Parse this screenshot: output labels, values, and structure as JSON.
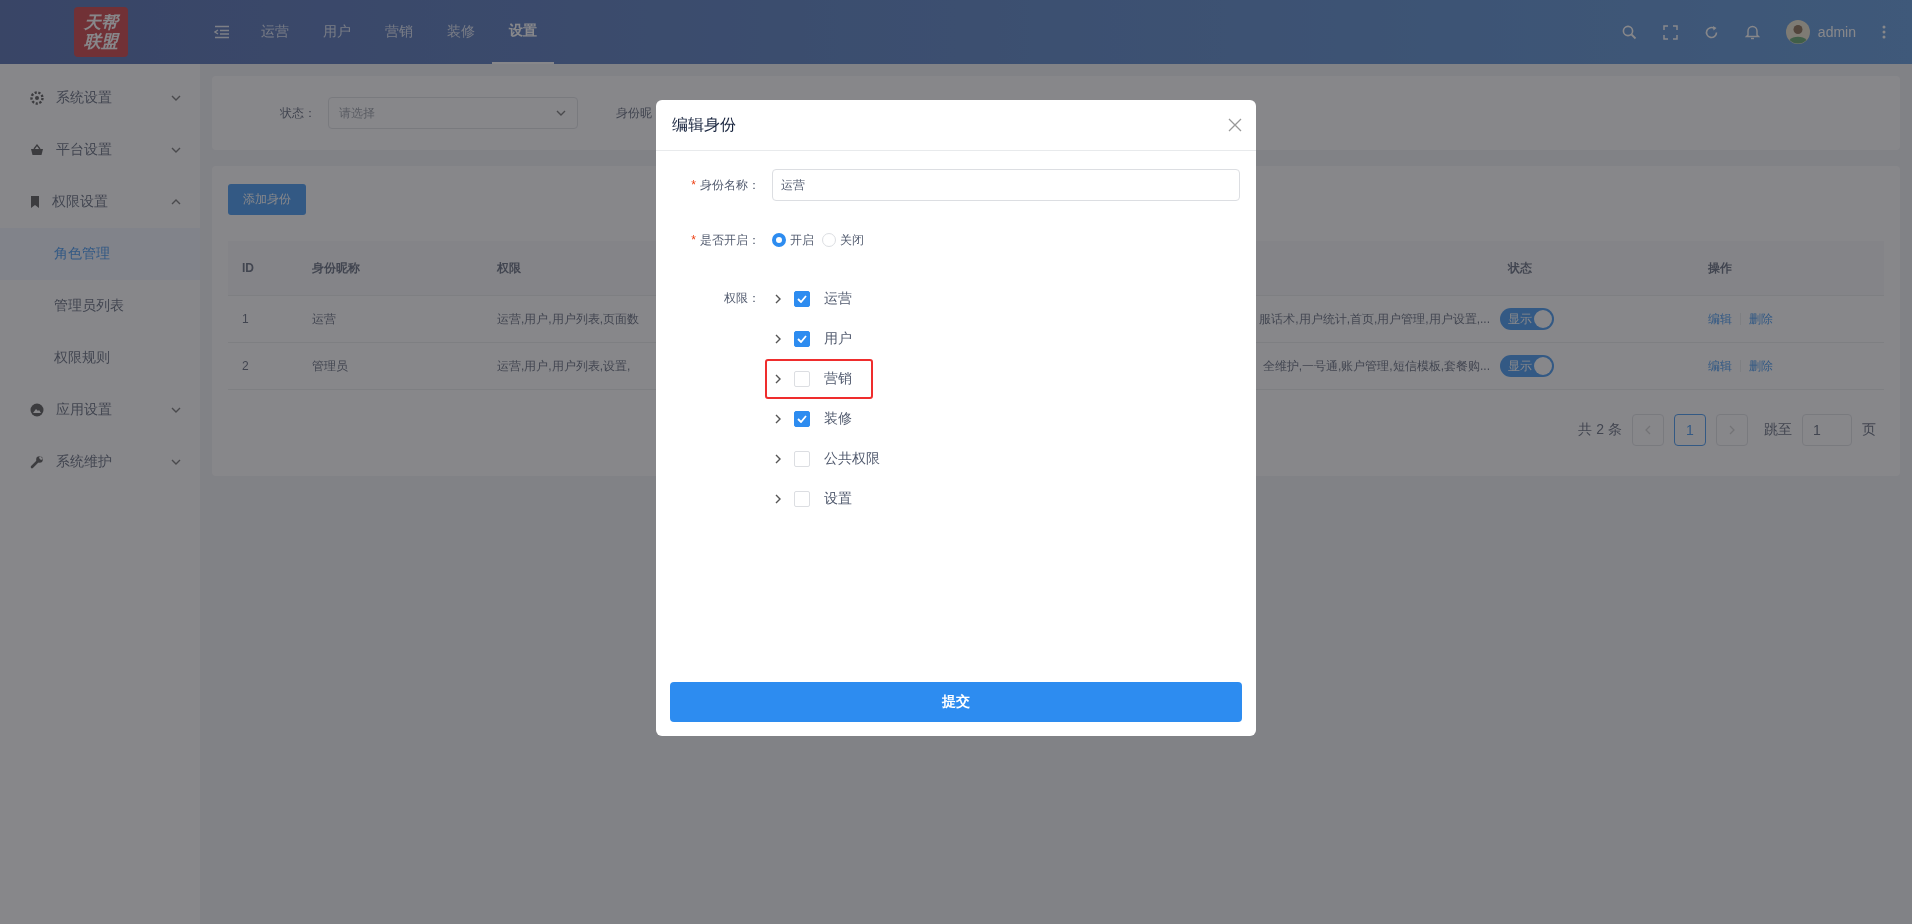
{
  "header": {
    "logo": [
      "天帮",
      "联盟"
    ],
    "nav": [
      {
        "label": "运营",
        "selected": false
      },
      {
        "label": "用户",
        "selected": false
      },
      {
        "label": "营销",
        "selected": false
      },
      {
        "label": "装修",
        "selected": false
      },
      {
        "label": "设置",
        "selected": true
      }
    ],
    "user": "admin"
  },
  "sidebar": {
    "items": [
      {
        "label": "系统设置",
        "kind": "gear",
        "expanded": false
      },
      {
        "label": "平台设置",
        "kind": "basket",
        "expanded": false
      },
      {
        "label": "权限设置",
        "kind": "bookmark",
        "expanded": true,
        "children": [
          {
            "label": "角色管理",
            "selected": true
          },
          {
            "label": "管理员列表",
            "selected": false
          },
          {
            "label": "权限规则",
            "selected": false
          }
        ]
      },
      {
        "label": "应用设置",
        "kind": "app",
        "expanded": false
      },
      {
        "label": "系统维护",
        "kind": "wrench",
        "expanded": false
      }
    ]
  },
  "filter": {
    "status_label": "状态：",
    "status_placeholder": "请选择",
    "name_label": "身份昵"
  },
  "add_button": "添加身份",
  "table": {
    "columns": [
      "ID",
      "身份昵称",
      "权限",
      "状态",
      "操作"
    ],
    "rows": [
      {
        "id": "1",
        "name": "运营",
        "perm_start": "运营,用户,用户列表,页面数",
        "perm_end": "服话术,用户统计,首页,用户管理,用户设置,...",
        "status": "显示",
        "on": true,
        "actions": [
          "编辑",
          "删除"
        ]
      },
      {
        "id": "2",
        "name": "管理员",
        "perm_start": "运营,用户,用户列表,设置,",
        "perm_end": "全维护,一号通,账户管理,短信模板,套餐购...",
        "status": "显示",
        "on": true,
        "actions": [
          "编辑",
          "删除"
        ]
      }
    ]
  },
  "pagination": {
    "total": "共 2 条",
    "pages": [
      {
        "label": "1",
        "selected": true
      }
    ],
    "jump_label": "跳至",
    "jump_value": "1",
    "suffix": "页"
  },
  "modal": {
    "title": "编辑身份",
    "name_field": {
      "label": "身份名称：",
      "required": true,
      "required_mark": "*",
      "value": "运营"
    },
    "enabled_field": {
      "label": "是否开启：",
      "required": true,
      "required_mark": "*",
      "options": [
        {
          "label": "开启",
          "selected": true
        },
        {
          "label": "关闭",
          "selected": false
        }
      ]
    },
    "perm_label": "权限：",
    "tree": [
      {
        "label": "运营",
        "checked": true,
        "highlighted": false
      },
      {
        "label": "用户",
        "checked": true,
        "highlighted": false
      },
      {
        "label": "营销",
        "checked": false,
        "highlighted": true
      },
      {
        "label": "装修",
        "checked": true,
        "highlighted": false
      },
      {
        "label": "公共权限",
        "checked": false,
        "highlighted": false
      },
      {
        "label": "设置",
        "checked": false,
        "highlighted": false
      }
    ],
    "submit": "提交"
  }
}
